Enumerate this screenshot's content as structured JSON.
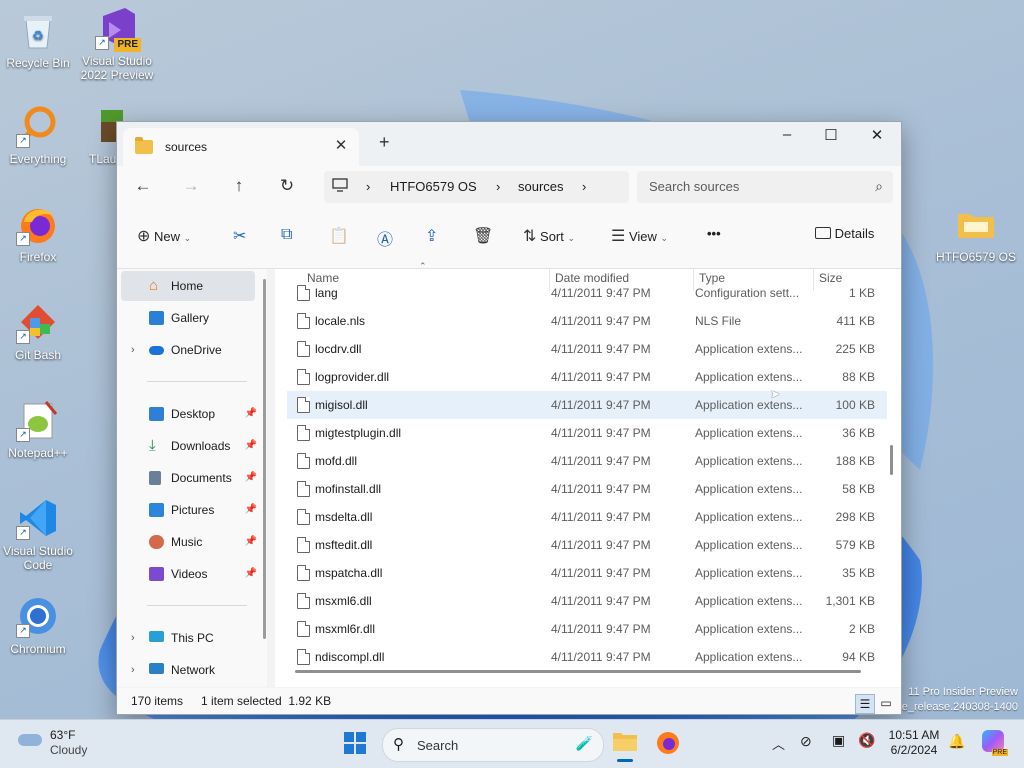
{
  "desktop": {
    "icons": [
      {
        "label": "Recycle Bin",
        "icon": "recycle-bin-icon"
      },
      {
        "label": "Visual Studio 2022 Preview",
        "icon": "visual-studio-icon",
        "badge": "PRE"
      },
      {
        "label": "Everything",
        "icon": "everything-search-icon"
      },
      {
        "label": "TLaun",
        "icon": "minecraft-launcher-icon"
      },
      {
        "label": "Firefox",
        "icon": "firefox-icon"
      },
      {
        "label": "Git Bash",
        "icon": "git-bash-icon"
      },
      {
        "label": "Notepad++",
        "icon": "notepadpp-icon"
      },
      {
        "label": "Visual Studio Code",
        "icon": "vscode-icon"
      },
      {
        "label": "Chromium",
        "icon": "chromium-icon"
      },
      {
        "label": "HTFO6579 OS",
        "icon": "drive-folder-icon"
      }
    ],
    "watermark": {
      "line1": "11 Pro Insider Preview",
      "line2": "e_release.240308-1400"
    }
  },
  "explorer": {
    "tab_title": "sources",
    "close_tab": "✕",
    "new_tab": "+",
    "controls": {
      "minimize": "–",
      "maximize": "☐",
      "close": "✕"
    },
    "nav": {
      "back": "←",
      "forward": "→",
      "up": "↑",
      "refresh": "↻"
    },
    "breadcrumb": {
      "sep": "›",
      "items": [
        "HTFO6579 OS",
        "sources"
      ]
    },
    "search_placeholder": "Search sources",
    "toolbar": {
      "new": "New",
      "sort": "Sort",
      "view": "View",
      "more": "•••",
      "details": "Details"
    },
    "sidebar": {
      "home": "Home",
      "gallery": "Gallery",
      "onedrive": "OneDrive",
      "quick": [
        {
          "label": "Desktop",
          "color": "#2f7fd6"
        },
        {
          "label": "Downloads",
          "color": "#1b8a4a"
        },
        {
          "label": "Documents",
          "color": "#6a7f99"
        },
        {
          "label": "Pictures",
          "color": "#2b86d9"
        },
        {
          "label": "Music",
          "color": "#d46a4a"
        },
        {
          "label": "Videos",
          "color": "#7c4ad1"
        }
      ],
      "this_pc": "This PC",
      "network": "Network"
    },
    "columns": {
      "name": "Name",
      "date": "Date modified",
      "type": "Type",
      "size": "Size"
    },
    "files": [
      {
        "name": "lang",
        "date": "4/11/2011 9:47 PM",
        "type": "Configuration sett...",
        "size": "1 KB"
      },
      {
        "name": "locale.nls",
        "date": "4/11/2011 9:47 PM",
        "type": "NLS File",
        "size": "411 KB"
      },
      {
        "name": "locdrv.dll",
        "date": "4/11/2011 9:47 PM",
        "type": "Application extens...",
        "size": "225 KB"
      },
      {
        "name": "logprovider.dll",
        "date": "4/11/2011 9:47 PM",
        "type": "Application extens...",
        "size": "88 KB"
      },
      {
        "name": "migisol.dll",
        "date": "4/11/2011 9:47 PM",
        "type": "Application extens...",
        "size": "100 KB"
      },
      {
        "name": "migtestplugin.dll",
        "date": "4/11/2011 9:47 PM",
        "type": "Application extens...",
        "size": "36 KB"
      },
      {
        "name": "mofd.dll",
        "date": "4/11/2011 9:47 PM",
        "type": "Application extens...",
        "size": "188 KB"
      },
      {
        "name": "mofinstall.dll",
        "date": "4/11/2011 9:47 PM",
        "type": "Application extens...",
        "size": "58 KB"
      },
      {
        "name": "msdelta.dll",
        "date": "4/11/2011 9:47 PM",
        "type": "Application extens...",
        "size": "298 KB"
      },
      {
        "name": "msftedit.dll",
        "date": "4/11/2011 9:47 PM",
        "type": "Application extens...",
        "size": "579 KB"
      },
      {
        "name": "mspatcha.dll",
        "date": "4/11/2011 9:47 PM",
        "type": "Application extens...",
        "size": "35 KB"
      },
      {
        "name": "msxml6.dll",
        "date": "4/11/2011 9:47 PM",
        "type": "Application extens...",
        "size": "1,301 KB"
      },
      {
        "name": "msxml6r.dll",
        "date": "4/11/2011 9:47 PM",
        "type": "Application extens...",
        "size": "2 KB"
      },
      {
        "name": "ndiscompl.dll",
        "date": "4/11/2011 9:47 PM",
        "type": "Application extens...",
        "size": "94 KB"
      }
    ],
    "status": {
      "count": "170 items",
      "selection": "1 item selected  1.92 KB"
    }
  },
  "taskbar": {
    "weather": {
      "temp": "63°F",
      "condition": "Cloudy"
    },
    "search": "Search",
    "clock": {
      "time": "10:51 AM",
      "date": "6/2/2024"
    },
    "tray": [
      "chevron-up-icon",
      "network-off-icon",
      "display-icon",
      "volume-mute-icon"
    ]
  },
  "colors": {
    "accent": "#0067c0",
    "selection": "#e6f0fb",
    "folder": "#f2c04a"
  }
}
